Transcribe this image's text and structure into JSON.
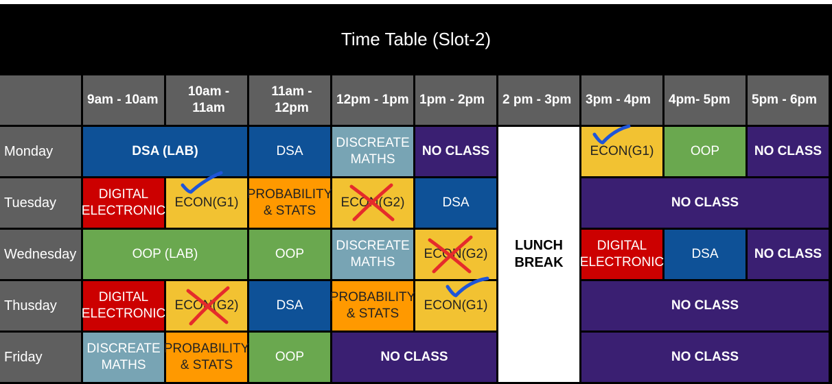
{
  "title": "Time Table (Slot-2)",
  "colors": {
    "header_gray": "#5f5f5f",
    "dsa_blue": "#0e5197",
    "teal": "#78a4b4",
    "purple": "#3a1f72",
    "yellow": "#f2c232",
    "green": "#6aa84f",
    "red": "#cc0000",
    "orange": "#ff9900",
    "lunch_white": "#ffffff",
    "check_blue": "#1f55d8",
    "cross_red": "#e52b2b"
  },
  "time_slots": [
    "9am - 10am",
    "10am - 11am",
    "11am - 12pm",
    "12pm - 1pm",
    "1pm - 2pm",
    "2 pm - 3pm",
    "3pm - 4pm",
    "4pm- 5pm",
    "5pm - 6pm"
  ],
  "days": [
    "Monday",
    "Tuesday",
    "Wednesday",
    "Thusday",
    "Friday"
  ],
  "lunch": "LUNCH\nBREAK",
  "schedule": {
    "monday": [
      "DSA (LAB)",
      "DSA",
      "DISCREATE\nMATHS",
      "NO CLASS",
      "ECON(G1)",
      "OOP",
      "NO CLASS"
    ],
    "tuesday": [
      "DIGITAL\nELECTRONIC",
      "ECON(G1)",
      "PROBABILITY\n& STATS",
      "ECON(G2)",
      "DSA",
      "NO CLASS"
    ],
    "wednesday": [
      "OOP (LAB)",
      "OOP",
      "DISCREATE\nMATHS",
      "ECON(G2)",
      "DIGITAL\nELECTRONIC",
      "DSA",
      "NO CLASS"
    ],
    "thusday": [
      "DIGITAL\nELECTRONIC",
      "ECON(G2)",
      "DSA",
      "PROBABILITY\n& STATS",
      "ECON(G1)",
      "NO CLASS"
    ],
    "friday": [
      "DISCREATE\nMATHS",
      "PROBABILITY\n& STATS",
      "OOP",
      "NO CLASS",
      "NO CLASS"
    ]
  },
  "marks": {
    "checked": [
      "Monday ECON(G1)",
      "Tuesday ECON(G1)",
      "Thusday ECON(G1)"
    ],
    "crossed": [
      "Tuesday ECON(G2)",
      "Wednesday ECON(G2)",
      "Thusday ECON(G2)"
    ]
  }
}
